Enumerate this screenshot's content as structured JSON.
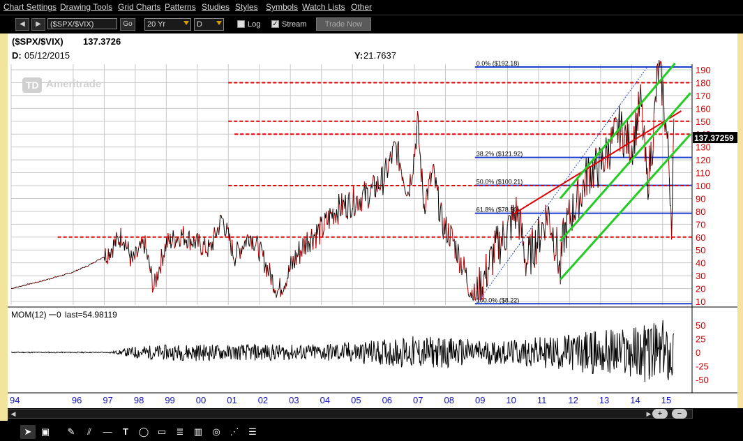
{
  "menu": [
    "Chart Settings",
    "Drawing Tools",
    "Grid Charts",
    "Patterns",
    "Studies",
    "Styles",
    "Symbols",
    "Watch Lists",
    "Other"
  ],
  "toolbar": {
    "symbol": "($SPX/$VIX)",
    "go_label": "Go",
    "period": "20 Yr",
    "interval": "D",
    "log_label": "Log",
    "log_checked": false,
    "stream_label": "Stream",
    "stream_checked": true,
    "trade_label": "Trade Now"
  },
  "header": {
    "symbol_text": "($SPX/$VIX)",
    "last_value": "137.3726",
    "date_label": "D:",
    "date_value": "05/12/2015",
    "y_label": "Y:",
    "y_value": "21.7637",
    "watermark": "Ameritrade",
    "watermark_badge": "TD",
    "last_tag": "137.37259"
  },
  "chart_data": [
    {
      "type": "line",
      "title": "($SPX/$VIX) 137.3726",
      "xlabel": "",
      "ylabel": "",
      "x_ticks": [
        "94",
        "96",
        "97",
        "98",
        "99",
        "00",
        "01",
        "02",
        "03",
        "04",
        "05",
        "06",
        "07",
        "08",
        "09",
        "10",
        "11",
        "12",
        "13",
        "14",
        "15"
      ],
      "y_ticks": [
        10,
        20,
        30,
        40,
        50,
        60,
        70,
        80,
        90,
        100,
        110,
        120,
        130,
        140,
        150,
        160,
        170,
        180,
        190
      ],
      "ylim": [
        10,
        194
      ],
      "grid": true,
      "series": [
        {
          "x": [
            1994.0,
            1995.0,
            1995.9,
            1996.5,
            1997.0,
            1997.6,
            1997.9,
            1998.3,
            1998.6,
            1998.75,
            1999.0,
            1999.5,
            2000.0,
            2000.4,
            2000.8,
            2001.2,
            2001.7,
            2002.0,
            2002.4,
            2002.6,
            2002.8,
            2003.2,
            2003.6,
            2004.0,
            2004.4,
            2004.8,
            2005.2,
            2005.6,
            2006.0,
            2006.4,
            2006.8,
            2007.0,
            2007.1,
            2007.3,
            2007.6,
            2007.9,
            2008.2,
            2008.6,
            2008.8,
            2008.95,
            2009.2,
            2009.6,
            2010.0,
            2010.3,
            2010.4,
            2010.6,
            2011.0,
            2011.3,
            2011.6,
            2011.7,
            2011.8,
            2012.0,
            2012.3,
            2012.6,
            2013.0,
            2013.3,
            2013.6,
            2014.0,
            2014.3,
            2014.5,
            2014.7,
            2014.85,
            2015.0,
            2015.2,
            2015.3,
            2015.36
          ],
          "values": [
            20,
            26,
            32,
            38,
            45,
            62,
            40,
            55,
            20,
            35,
            55,
            62,
            55,
            50,
            75,
            45,
            62,
            50,
            28,
            18,
            25,
            45,
            60,
            65,
            80,
            85,
            90,
            95,
            105,
            130,
            95,
            125,
            150,
            85,
            110,
            70,
            60,
            35,
            20,
            12,
            25,
            50,
            65,
            80,
            70,
            40,
            60,
            80,
            50,
            30,
            60,
            75,
            90,
            110,
            115,
            130,
            145,
            130,
            165,
            100,
            140,
            190,
            175,
            120,
            70,
            137.4
          ]
        }
      ],
      "annotations": [
        {
          "label": "0.0% ($192.18)",
          "value": 192.18
        },
        {
          "label": "38.2% ($121.92)",
          "value": 121.92
        },
        {
          "label": "50.0% ($100.21)",
          "value": 100.21
        },
        {
          "label": "61.8% ($78.50)",
          "value": 78.5
        },
        {
          "label": "100.0% ($8.22)",
          "value": 8.22
        }
      ],
      "horizontal_levels": [
        60,
        100,
        140,
        150,
        180
      ],
      "last_value": 137.37259
    },
    {
      "type": "line",
      "title": "MOM(12)",
      "legend": "MOM(12)",
      "last_label": "0",
      "last_value_label": "last=54.98119",
      "y_ticks": [
        50,
        25,
        0,
        -25,
        -50
      ],
      "ylim": [
        -70,
        70
      ],
      "grid": false,
      "series": [
        {
          "x": [
            1994.0,
            1997.0,
            1997.5,
            1998.0,
            1999.0,
            2000.0,
            2001.0,
            2002.0,
            2003.0,
            2004.0,
            2005.0,
            2006.0,
            2007.0,
            2008.0,
            2009.0,
            2010.0,
            2011.0,
            2012.0,
            2013.0,
            2014.0,
            2014.5,
            2014.8,
            2015.0,
            2015.2,
            2015.36
          ],
          "values": [
            0,
            0,
            4,
            12,
            14,
            16,
            14,
            16,
            14,
            16,
            20,
            24,
            30,
            28,
            24,
            22,
            28,
            34,
            42,
            48,
            55,
            55,
            -60,
            55,
            54.98
          ]
        }
      ]
    }
  ],
  "colors": {
    "price_up": "#000000",
    "price_down": "#cc0000",
    "fib_line": "#1a3fcf",
    "level_line": "#e00000",
    "channel_line": "#22cc22",
    "trend_line": "#e00000",
    "axis_text_red": "#cc0000",
    "axis_text_blue": "#1010c0"
  },
  "drawing_tools": [
    "pointer-icon",
    "crosshair-icon",
    "pencil-icon",
    "parallel-lines-icon",
    "horizontal-line-icon",
    "text-icon",
    "ellipse-icon",
    "rectangle-icon",
    "fibonacci-icon",
    "gann-icon",
    "spiral-icon",
    "fan-icon",
    "list-icon"
  ]
}
